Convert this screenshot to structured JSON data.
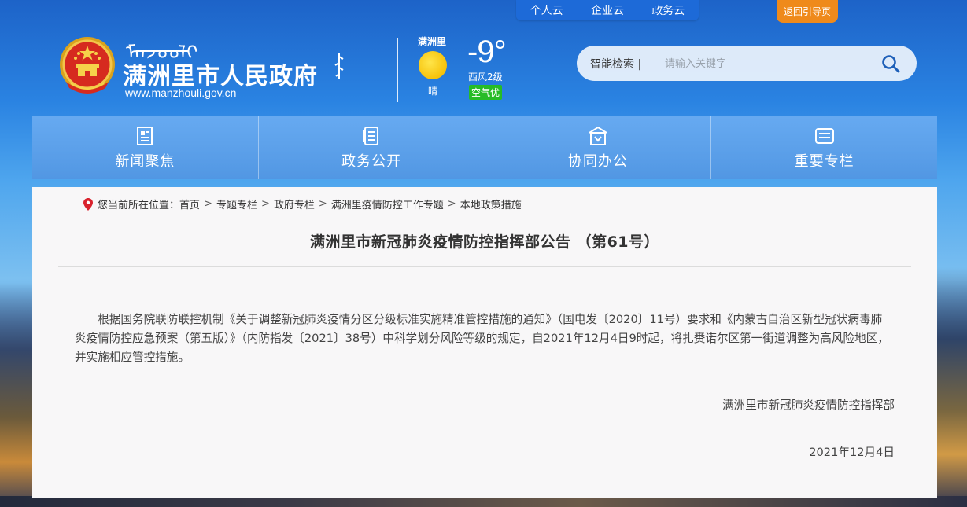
{
  "top_links": [
    "个人云",
    "企业云",
    "政务云"
  ],
  "back_guide": "返回引导页",
  "logo": {
    "mongol_text": "ᠮᠠᠨᠵᠤᠤᠯᠢ",
    "site_name": "满洲里市人民政府",
    "url": "www.manzhouli.gov.cn"
  },
  "weather": {
    "city": "满洲里",
    "condition": "晴",
    "temperature": "-9°",
    "wind": "西风2级",
    "air_quality": "空气优"
  },
  "search": {
    "label": "智能检索 |",
    "placeholder": "请输入关键字"
  },
  "nav": [
    {
      "label": "新闻聚焦",
      "icon": "news-icon"
    },
    {
      "label": "政务公开",
      "icon": "document-icon"
    },
    {
      "label": "协同办公",
      "icon": "office-icon"
    },
    {
      "label": "重要专栏",
      "icon": "column-icon"
    }
  ],
  "breadcrumb": {
    "prefix": "您当前所在位置：",
    "items": [
      "首页",
      "专题专栏",
      "政府专栏",
      "满洲里疫情防控工作专题",
      "本地政策措施"
    ],
    "separator": ">"
  },
  "article": {
    "title": "满洲里市新冠肺炎疫情防控指挥部公告 （第61号）",
    "body": "根据国务院联防联控机制《关于调整新冠肺炎疫情分区分级标准实施精准管控措施的通知》（国电发〔2020〕11号）要求和《内蒙古自治区新型冠状病毒肺炎疫情防控应急预案（第五版）》（内防指发〔2021〕38号）中科学划分风险等级的规定，自2021年12月4日9时起，将扎赉诺尔区第一街道调整为高风险地区，并实施相应管控措施。",
    "signature": "满洲里市新冠肺炎疫情防控指挥部",
    "date": "2021年12月4日"
  },
  "colors": {
    "header_blue": "#1d6ad8",
    "orange_button": "#ef8a1b",
    "aqi_green": "#26bc26",
    "sun_yellow": "#f6c20a"
  }
}
